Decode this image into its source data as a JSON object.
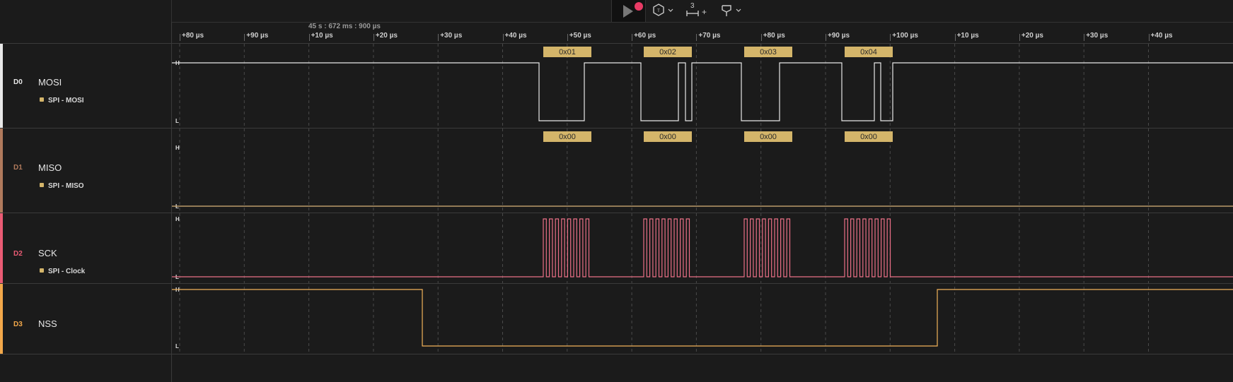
{
  "toolbar": {
    "capture_icon": "play-icon",
    "record_indicator": "record-dot-icon",
    "trigger_icon": "hexagon-trigger-icon",
    "measure_label": "3",
    "measure_add": "+",
    "marker_icon": "marker-flag-icon",
    "chevron": "⌄"
  },
  "ruler": {
    "absolute_time": "45 s : 672 ms : 900 µs",
    "ticks": [
      "+80 µs",
      "+90 µs",
      "+10 µs",
      "+20 µs",
      "+30 µs",
      "+40 µs",
      "+50 µs",
      "+60 µs",
      "+70 µs",
      "+80 µs",
      "+90 µs",
      "+100 µs",
      "+10 µs",
      "+20 µs",
      "+30 µs",
      "+40 µs"
    ]
  },
  "channels": [
    {
      "id": "D0",
      "name": "MOSI",
      "analyzer": "SPI - MOSI",
      "color": "#e8e8e8",
      "high": "H",
      "low": "L",
      "decoded": [
        "0x01",
        "0x02",
        "0x03",
        "0x04"
      ]
    },
    {
      "id": "D1",
      "name": "MISO",
      "analyzer": "SPI - MISO",
      "color": "#b07a5c",
      "high": "H",
      "low": "L",
      "decoded": [
        "0x00",
        "0x00",
        "0x00",
        "0x00"
      ]
    },
    {
      "id": "D2",
      "name": "SCK",
      "analyzer": "SPI - Clock",
      "color": "#ea5b74",
      "high": "H",
      "low": "L"
    },
    {
      "id": "D3",
      "name": "NSS",
      "analyzer": "",
      "color": "#f2a84a",
      "high": "H",
      "low": "L"
    }
  ],
  "colors": {
    "background": "#1b1b1b",
    "mosi_wave": "#e8e8e8",
    "miso_wave": "#d9b47a",
    "sck_wave": "#ea6f86",
    "nss_wave": "#f2b25a",
    "decode_box": "#d4b56a",
    "decode_text": "#2a2a2a"
  }
}
